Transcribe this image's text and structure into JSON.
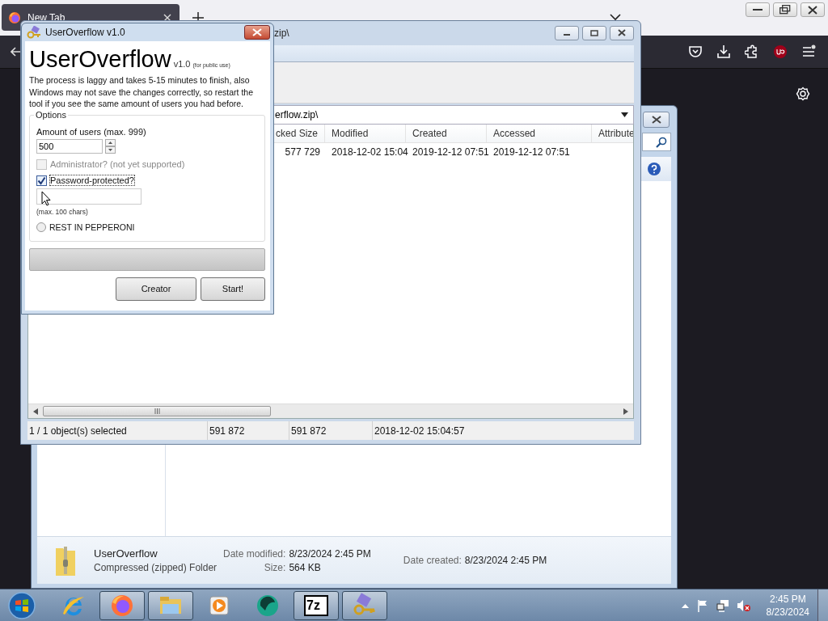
{
  "browser": {
    "tab": {
      "title": "New Tab",
      "selected": true
    }
  },
  "explorer": {
    "file_name": "UserOverflow",
    "file_type": "Compressed (zipped) Folder",
    "details": [
      [
        {
          "label": "Date modified:",
          "value": "8/23/2024 2:45 PM"
        },
        {
          "label": "Size:",
          "value": "564 KB"
        }
      ],
      [
        {
          "label": "Date created:",
          "value": "8/23/2024 2:45 PM"
        }
      ]
    ]
  },
  "zip_window": {
    "title": "zip\\",
    "address": "erflow.zip\\",
    "columns": [
      "cked Size",
      "Modified",
      "Created",
      "Accessed",
      "Attribute"
    ],
    "rows": [
      {
        "cells": [
          "577 729",
          "2018-12-02 15:04",
          "2019-12-12 07:51",
          "2019-12-12 07:51"
        ],
        "selected": false
      }
    ],
    "status_bar": [
      "1 / 1 object(s) selected",
      "591 872",
      "591 872",
      "2018-12-02 15:04:57"
    ]
  },
  "dialog": {
    "title": "UserOverflow v1.0",
    "heading": "UserOverflow",
    "version": "v1.0",
    "note": "(for public use)",
    "description": "The process is laggy and takes 5-15 minutes to finish, also Windows may not save the changes correctly, so restart the tool if you see the same amount of users you had before.",
    "options": {
      "title": "Options",
      "users_label": "Amount of users (max. 999)",
      "users_value": "500",
      "checkboxes": [
        {
          "label": "Administrator? (not yet supported)",
          "checked": false,
          "disabled": true
        },
        {
          "label": "Password-protected?",
          "checked": true,
          "disabled": false
        }
      ],
      "password_hint": "(max. 100 chars)",
      "radio": {
        "label": "REST IN PEPPERONI",
        "selected": false
      }
    },
    "progress": {
      "level": 0
    },
    "buttons": [
      "Creator",
      "Start!"
    ]
  },
  "taskbar": {
    "apps": [
      {
        "kind": "ie",
        "running": false
      },
      {
        "kind": "firefox",
        "running": true
      },
      {
        "kind": "explorer",
        "running": true
      },
      {
        "kind": "media",
        "running": false
      },
      {
        "kind": "circle",
        "running": false
      },
      {
        "kind": "sevenzip",
        "label": "7z",
        "running": true
      },
      {
        "kind": "keys",
        "running": true
      }
    ],
    "clock": {
      "time": "2:45 PM",
      "date": "8/23/2024"
    }
  }
}
